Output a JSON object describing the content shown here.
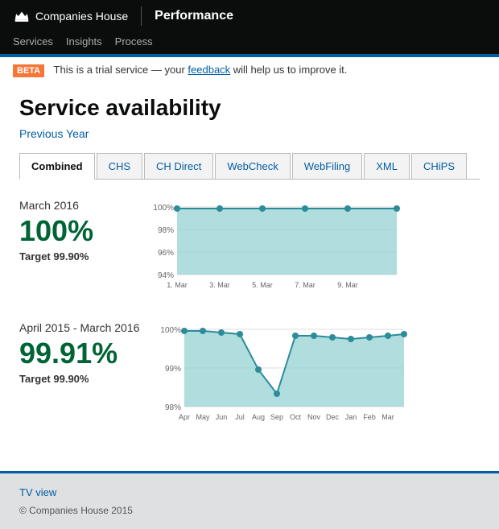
{
  "header": {
    "brand": "Companies House",
    "title": "Performance",
    "nav": [
      "Services",
      "Insights",
      "Process"
    ]
  },
  "beta_banner": {
    "tag": "BETA",
    "text": "This is a trial service — your ",
    "link_text": "feedback",
    "text_after": " will help us to improve it."
  },
  "page": {
    "title": "Service availability",
    "prev_year_link": "Previous Year"
  },
  "tabs": [
    {
      "label": "Combined",
      "active": true
    },
    {
      "label": "CHS",
      "active": false
    },
    {
      "label": "CH Direct",
      "active": false
    },
    {
      "label": "WebCheck",
      "active": false
    },
    {
      "label": "WebFiling",
      "active": false
    },
    {
      "label": "XML",
      "active": false
    },
    {
      "label": "CHiPS",
      "active": false
    }
  ],
  "charts": [
    {
      "period": "March 2016",
      "value": "100%",
      "target_label": "Target 99.90%",
      "x_labels": [
        "1. Mar",
        "3. Mar",
        "5. Mar",
        "7. Mar",
        "9. Mar"
      ],
      "y_labels": [
        "100%",
        "98%",
        "96%",
        "94%"
      ],
      "type": "flat_high"
    },
    {
      "period": "April 2015 - March 2016",
      "value": "99.91%",
      "target_label": "Target 99.90%",
      "x_labels": [
        "Apr",
        "May",
        "Jun",
        "Jul",
        "Aug",
        "Sep",
        "Oct",
        "Nov",
        "Dec",
        "Jan",
        "Feb",
        "Mar"
      ],
      "y_labels": [
        "100%",
        "99%",
        "98%"
      ],
      "type": "with_dip"
    }
  ],
  "footer": {
    "tv_link": "TV view",
    "copyright": "© Companies House 2015"
  }
}
